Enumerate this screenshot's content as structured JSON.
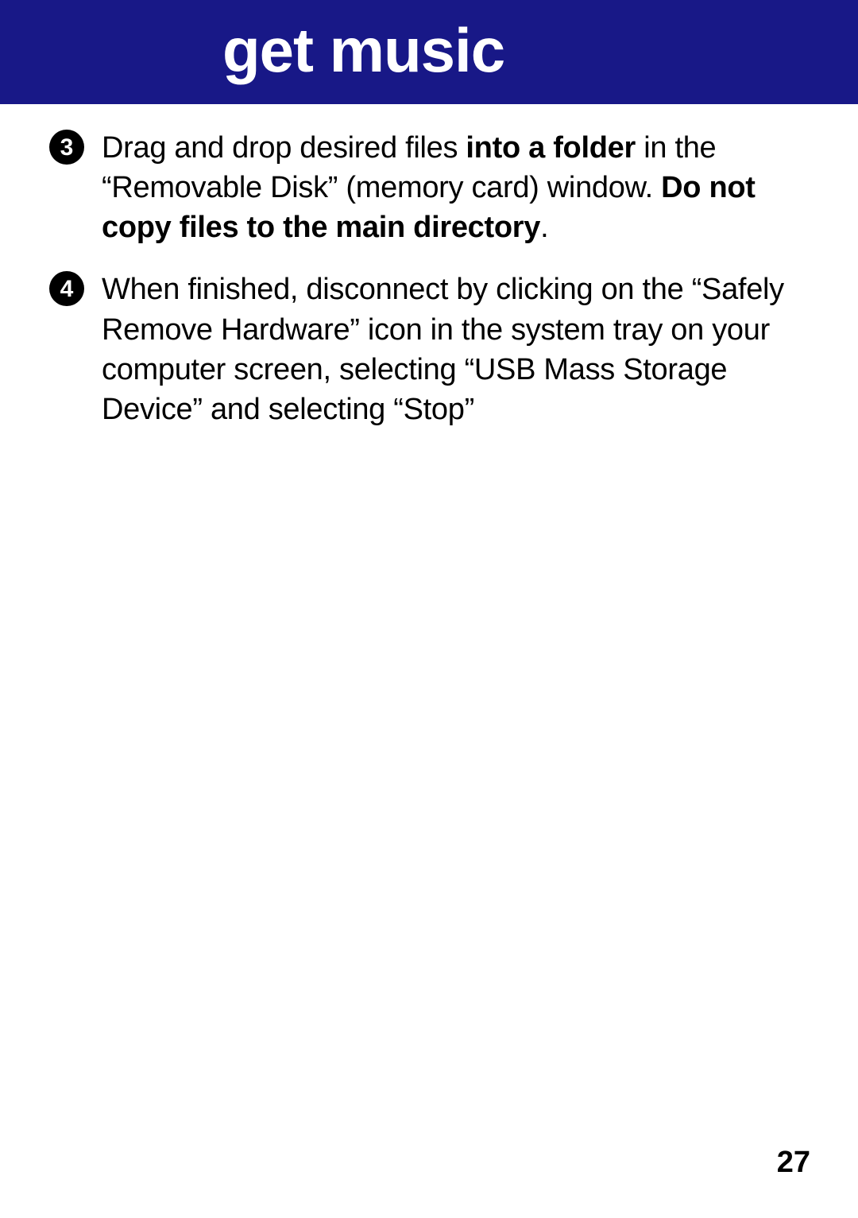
{
  "header": {
    "title": "get music"
  },
  "steps": [
    {
      "marker": "3",
      "segments": [
        {
          "text": "Drag and drop desired files ",
          "bold": false
        },
        {
          "text": "into a folder",
          "bold": true
        },
        {
          "text": " in the “Removable Disk” (memory card) window. ",
          "bold": false
        },
        {
          "text": "Do not copy files to the main directory",
          "bold": true
        },
        {
          "text": ".",
          "bold": false
        }
      ]
    },
    {
      "marker": "4",
      "segments": [
        {
          "text": "When finished, disconnect by clicking on the “Safely Remove Hardware” icon in the system tray on your computer screen, selecting “USB Mass Storage Device” and selecting “Stop”",
          "bold": false
        }
      ]
    }
  ],
  "page_number": "27"
}
